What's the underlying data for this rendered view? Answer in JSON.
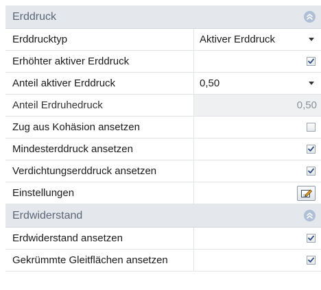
{
  "sections": [
    {
      "title": "Erddruck",
      "collapse_icon": "double-chevron-up-icon",
      "rows": {
        "typ": {
          "label": "Erddrucktyp",
          "value": "Aktiver Erddruck"
        },
        "erhoeht": {
          "label": "Erhöhter aktiver Erddruck",
          "checked": true
        },
        "anteil_aktiv": {
          "label": "Anteil aktiver Erddruck",
          "value": "0,50"
        },
        "anteil_ruhe": {
          "label": "Anteil Erdruhedruck",
          "value": "0,50"
        },
        "zug": {
          "label": "Zug aus Kohäsion ansetzen",
          "checked": false
        },
        "mindest": {
          "label": "Mindesterddruck ansetzen",
          "checked": true
        },
        "verdichtung": {
          "label": "Verdichtungserddruck ansetzen",
          "checked": true
        },
        "einstellungen": {
          "label": "Einstellungen",
          "button_icon": "edit-pencil-icon"
        }
      }
    },
    {
      "title": "Erdwiderstand",
      "collapse_icon": "double-chevron-up-icon",
      "rows": {
        "ansetzen": {
          "label": "Erdwiderstand ansetzen",
          "checked": true
        },
        "gekruemmt": {
          "label": "Gekrümmte Gleitflächen ansetzen",
          "checked": true
        }
      }
    }
  ],
  "colors": {
    "header_bg": "#e4e7ec",
    "header_text": "#5b6777",
    "check_mark": "#2b4f86",
    "disabled_bg": "#eef0f2"
  }
}
